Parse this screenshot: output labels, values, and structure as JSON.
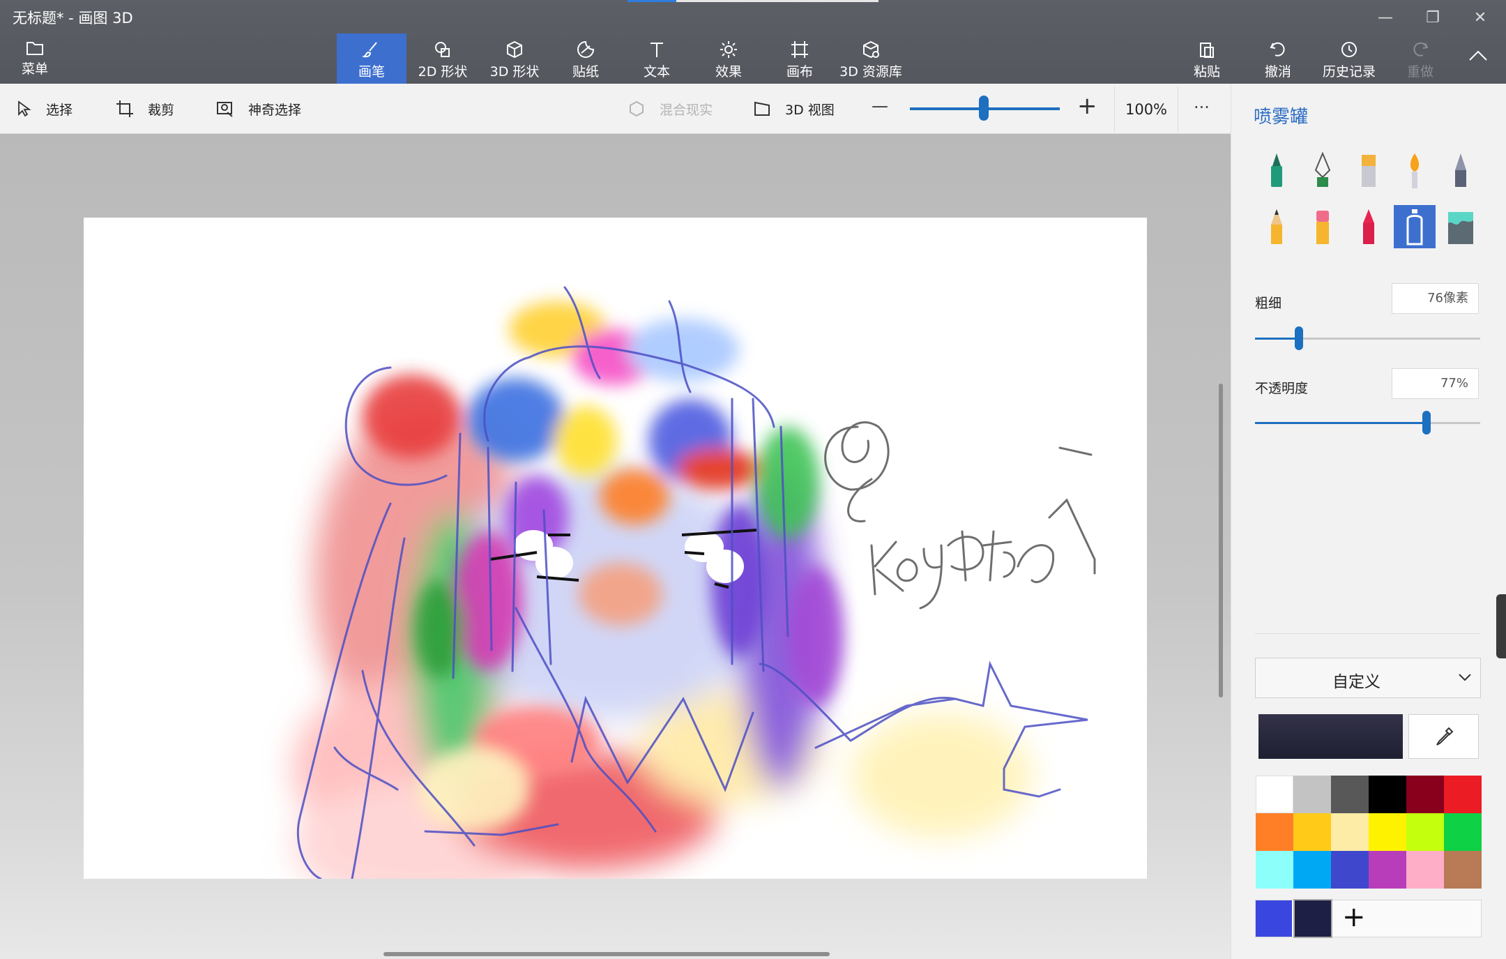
{
  "window": {
    "title": "无标题* - 画图 3D",
    "controls": {
      "minimize": "—",
      "restore": "❐",
      "close": "✕"
    }
  },
  "topbar": {
    "menu_label": "菜单",
    "tabs": [
      {
        "label": "画笔",
        "icon": "brush-icon",
        "active": true
      },
      {
        "label": "2D 形状",
        "icon": "2d-shapes-icon"
      },
      {
        "label": "3D 形状",
        "icon": "3d-shapes-icon"
      },
      {
        "label": "贴纸",
        "icon": "stickers-icon"
      },
      {
        "label": "文本",
        "icon": "text-icon"
      },
      {
        "label": "效果",
        "icon": "effects-icon"
      },
      {
        "label": "画布",
        "icon": "canvas-icon"
      },
      {
        "label": "3D 资源库",
        "icon": "3d-library-icon"
      }
    ],
    "actions": [
      {
        "label": "粘贴",
        "icon": "paste-icon"
      },
      {
        "label": "撤消",
        "icon": "undo-icon"
      },
      {
        "label": "历史记录",
        "icon": "history-icon"
      },
      {
        "label": "重做",
        "icon": "redo-icon",
        "disabled": true
      }
    ]
  },
  "toolbar": {
    "select": "选择",
    "crop": "裁剪",
    "magic_select": "神奇选择",
    "mixed_reality": "混合现实",
    "view_3d": "3D 视图",
    "zoom_minus": "—",
    "zoom_plus": "+",
    "zoom_level": "100%",
    "zoom_fraction": 0.49,
    "more": "···"
  },
  "panel": {
    "title": "喷雾罐",
    "brushes": [
      "marker-icon",
      "calligraphy-pen-icon",
      "oil-brush-icon",
      "watercolor-icon",
      "pixel-pen-icon",
      "pencil-icon",
      "eraser-icon",
      "crayon-icon",
      "spray-can-icon",
      "fill-icon"
    ],
    "active_brush": "spray-can-icon",
    "thickness": {
      "label": "粗细",
      "value": "76像素",
      "fraction": 0.2
    },
    "opacity": {
      "label": "不透明度",
      "value": "77%",
      "fraction": 0.77
    },
    "color_dropdown": "自定义",
    "current_color": "#262538",
    "palette": [
      "#ffffff",
      "#c3c3c3",
      "#585858",
      "#000000",
      "#88001b",
      "#ec1c24",
      "#ff7f27",
      "#ffca18",
      "#fdeca6",
      "#fff200",
      "#c4ff0e",
      "#0ed145",
      "#8cfffb",
      "#00a8f3",
      "#3f48cc",
      "#b83dba",
      "#ffaec8",
      "#b97a56"
    ],
    "recent_colors": [
      "#3a46e0",
      "#1e1f44"
    ],
    "add_color": "+"
  },
  "canvas": {
    "signature_text": "@Kogetsi"
  }
}
